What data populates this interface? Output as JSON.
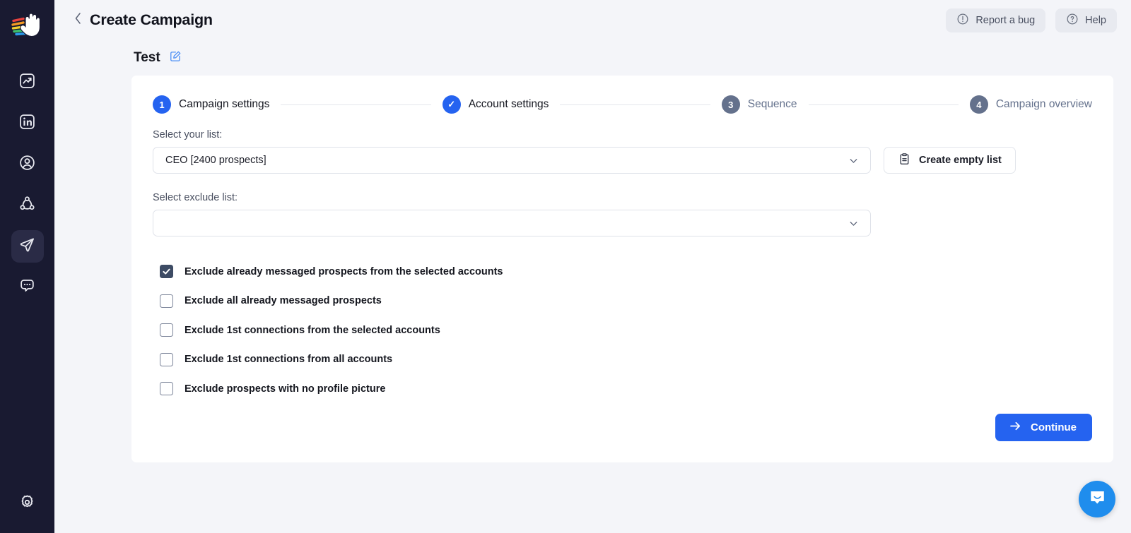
{
  "sidebar": {
    "logo_name": "waving-hand-logo",
    "items": [
      {
        "icon": "analytics-chart-icon",
        "active": false
      },
      {
        "icon": "linkedin-icon",
        "active": false
      },
      {
        "icon": "user-circle-icon",
        "active": false
      },
      {
        "icon": "network-nodes-icon",
        "active": false
      },
      {
        "icon": "send-plane-icon",
        "active": true
      },
      {
        "icon": "chat-bubble-dots-icon",
        "active": false
      }
    ],
    "bottom_item": {
      "icon": "gear-icon"
    }
  },
  "header": {
    "back_icon": "chevron-left-icon",
    "title": "Create Campaign",
    "report_bug": {
      "label": "Report a bug",
      "icon": "exclamation-circle-icon"
    },
    "help": {
      "label": "Help",
      "icon": "question-circle-icon"
    }
  },
  "campaign": {
    "name": "Test",
    "edit_icon": "edit-pencil-icon"
  },
  "stepper": {
    "steps": [
      {
        "badge": "1",
        "label": "Campaign settings",
        "state": "current"
      },
      {
        "badge": "✓",
        "label": "Account settings",
        "state": "done"
      },
      {
        "badge": "3",
        "label": "Sequence",
        "state": "todo"
      },
      {
        "badge": "4",
        "label": "Campaign overview",
        "state": "todo"
      }
    ]
  },
  "form": {
    "list_label": "Select your list:",
    "list_value": "CEO [2400 prospects]",
    "list_placeholder": "Select your list",
    "exclude_label": "Select exclude list:",
    "exclude_value": "",
    "exclude_placeholder": "",
    "create_empty_list": {
      "label": "Create empty list",
      "icon": "clipboard-icon"
    },
    "chevron_icon": "chevron-down-icon"
  },
  "checkboxes": [
    {
      "label": "Exclude already messaged prospects from the selected accounts",
      "checked": true
    },
    {
      "label": "Exclude all already messaged prospects",
      "checked": false
    },
    {
      "label": "Exclude 1st connections from the selected accounts",
      "checked": false
    },
    {
      "label": "Exclude 1st connections from all accounts",
      "checked": false
    },
    {
      "label": "Exclude prospects with no profile picture",
      "checked": false
    }
  ],
  "footer": {
    "continue_label": "Continue",
    "continue_icon": "arrow-right-icon"
  },
  "chat_widget": {
    "icon": "intercom-chat-icon"
  },
  "colors": {
    "accent_blue": "#2563f0",
    "sidebar_bg": "#191a31",
    "page_bg": "#f4f5f9",
    "step_todo": "#64718c",
    "checkbox_on": "#3d4b64",
    "intercom_blue": "#1f8ded"
  }
}
